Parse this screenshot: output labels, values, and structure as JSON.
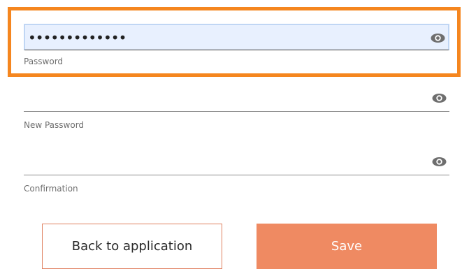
{
  "form": {
    "fields": [
      {
        "value": "•••••••••••••",
        "label": "Password",
        "icon": "eye-icon"
      },
      {
        "value": "",
        "label": "New Password",
        "icon": "eye-icon"
      },
      {
        "value": "",
        "label": "Confirmation",
        "icon": "eye-icon"
      }
    ],
    "focused_field": "Password"
  },
  "buttons": {
    "back_label": "Back to application",
    "save_label": "Save"
  },
  "colors": {
    "highlight": "#f5861f",
    "accent": "#ef8a62",
    "focused_input_bg": "#e8f0fe"
  }
}
